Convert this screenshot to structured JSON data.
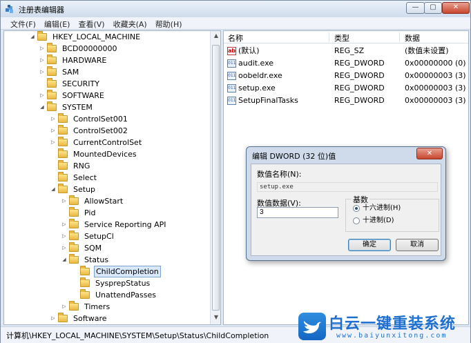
{
  "window": {
    "title": "注册表编辑器",
    "min_glyph": "—",
    "max_glyph": "▢",
    "close_glyph": "✕"
  },
  "menu": [
    "文件(F)",
    "编辑(E)",
    "查看(V)",
    "收藏夹(A)",
    "帮助(H)"
  ],
  "tree": [
    {
      "label": "HKEY_LOCAL_MACHINE",
      "expander": "◢"
    },
    {
      "label": "BCD00000000",
      "expander": "▷"
    },
    {
      "label": "HARDWARE",
      "expander": "▷"
    },
    {
      "label": "SAM",
      "expander": "▷"
    },
    {
      "label": "SECURITY",
      "expander": ""
    },
    {
      "label": "SOFTWARE",
      "expander": "▷"
    },
    {
      "label": "SYSTEM",
      "expander": "◢"
    },
    {
      "label": "ControlSet001",
      "expander": "▷"
    },
    {
      "label": "ControlSet002",
      "expander": "▷"
    },
    {
      "label": "CurrentControlSet",
      "expander": "▷"
    },
    {
      "label": "MountedDevices",
      "expander": ""
    },
    {
      "label": "RNG",
      "expander": ""
    },
    {
      "label": "Select",
      "expander": ""
    },
    {
      "label": "Setup",
      "expander": "◢"
    },
    {
      "label": "AllowStart",
      "expander": "▷"
    },
    {
      "label": "Pid",
      "expander": ""
    },
    {
      "label": "Service Reporting API",
      "expander": "▷"
    },
    {
      "label": "SetupCl",
      "expander": "▷"
    },
    {
      "label": "SQM",
      "expander": "▷"
    },
    {
      "label": "Status",
      "expander": "◢"
    },
    {
      "label": "ChildCompletion",
      "expander": "",
      "selected": true
    },
    {
      "label": "SysprepStatus",
      "expander": ""
    },
    {
      "label": "UnattendPasses",
      "expander": ""
    },
    {
      "label": "Timers",
      "expander": "▷"
    },
    {
      "label": "Software",
      "expander": "▷"
    }
  ],
  "list": {
    "headers": [
      "名称",
      "类型",
      "数据"
    ],
    "rows": [
      {
        "name": "(默认)",
        "type": "REG_SZ",
        "data": "(数值未设置)",
        "icon": "ab"
      },
      {
        "name": "audit.exe",
        "type": "REG_DWORD",
        "data": "0x00000000 (0)",
        "icon": "011"
      },
      {
        "name": "oobeldr.exe",
        "type": "REG_DWORD",
        "data": "0x00000003 (3)",
        "icon": "011"
      },
      {
        "name": "setup.exe",
        "type": "REG_DWORD",
        "data": "0x00000003 (3)",
        "icon": "011"
      },
      {
        "name": "SetupFinalTasks",
        "type": "REG_DWORD",
        "data": "0x00000003 (3)",
        "icon": "011"
      }
    ]
  },
  "status": "计算机\\HKEY_LOCAL_MACHINE\\SYSTEM\\Setup\\Status\\ChildCompletion",
  "dialog": {
    "title": "编辑 DWORD (32 位)值",
    "close_glyph": "✕",
    "name_label": "数值名称(N):",
    "name_value": "setup.exe",
    "data_label": "数值数据(V):",
    "data_value": "3",
    "base_label": "基数",
    "hex_label": "十六进制(H)",
    "dec_label": "十进制(D)",
    "ok_label": "确定",
    "cancel_label": "取消"
  },
  "watermark": {
    "title": "白云一键重装系统",
    "url": "www.baiyunxitong.com"
  }
}
